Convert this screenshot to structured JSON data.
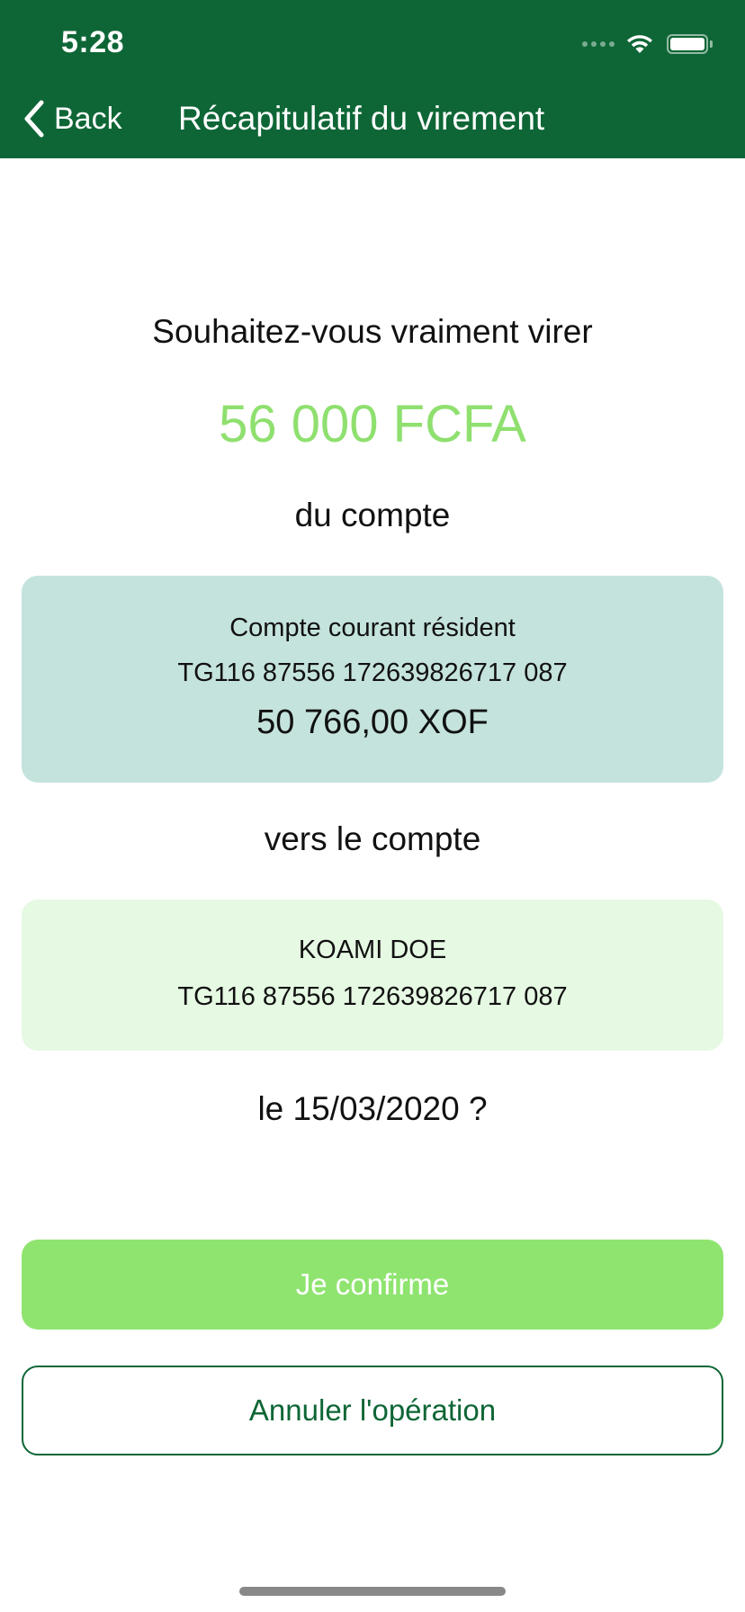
{
  "status_bar": {
    "time": "5:28"
  },
  "nav": {
    "back_label": "Back",
    "title": "Récapitulatif du virement"
  },
  "summary": {
    "prompt": "Souhaitez-vous vraiment virer",
    "amount": "56 000 FCFA",
    "from_label": "du compte",
    "source_account": {
      "name": "Compte courant résident",
      "iban": "TG116 87556 172639826717 087",
      "balance": "50 766,00 XOF"
    },
    "to_label": "vers le compte",
    "destination_account": {
      "name": "KOAMI DOE",
      "iban": "TG116 87556 172639826717 087"
    },
    "date_line": "le 15/03/2020 ?"
  },
  "actions": {
    "confirm_label": "Je confirme",
    "cancel_label": "Annuler l'opération"
  },
  "colors": {
    "header_bg": "#0e6636",
    "amount": "#8fe06f",
    "source_card_bg": "#c5e3dd",
    "destination_card_bg": "#e6f9e3",
    "confirm_bg": "#8fe46f",
    "cancel_border": "#0e6636"
  },
  "icons": {
    "back": "chevron-left-icon",
    "wifi": "wifi-icon",
    "battery": "battery-icon",
    "signal": "cellular-signal-icon"
  }
}
